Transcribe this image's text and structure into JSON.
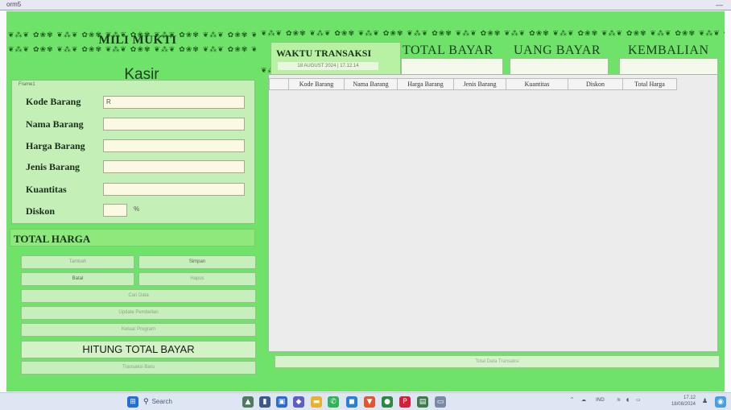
{
  "window": {
    "title": "orm5",
    "minimize": "—"
  },
  "brand": {
    "ornament": "❦⁂❦ ✿❀✾ ❦⁂❦ ✿❀✾ ❦⁂❦ ✿❀✾ ❦⁂❦ ✿❀✾ ❦⁂❦ ✿❀✾ ❦⁂❦ ✿❀✾ ❦⁂❦ ✿❀✾ ❦⁂❦ ✿❀✾ ❦⁂❦ ✿❀✾ ❦⁂❦ ✿❀✾ ❦⁂❦ ✿❀✾ ❦⁂❦ ✿❀✾ ❦⁂❦",
    "title": "MILI MUKTI",
    "subtitle": "Kasir"
  },
  "transaction": {
    "time_label": "WAKTU TRANSAKSI",
    "time_value": "18 AUGUST 2024 | 17.12.14"
  },
  "summary": {
    "total_bayar_label": "TOTAL BAYAR",
    "uang_bayar_label": "UANG BAYAR",
    "kembalian_label": "KEMBALIAN",
    "total_bayar_value": "",
    "uang_bayar_value": "",
    "kembalian_value": ""
  },
  "form": {
    "frame_caption": "Frame1",
    "kode_barang_label": "Kode Barang",
    "kode_barang_value": "R",
    "nama_barang_label": "Nama Barang",
    "nama_barang_value": "",
    "harga_barang_label": "Harga Barang",
    "harga_barang_value": "",
    "jenis_barang_label": "Jenis Barang",
    "jenis_barang_value": "",
    "kuantitas_label": "Kuantitas",
    "kuantitas_value": "",
    "diskon_label": "Diskon",
    "diskon_value": "",
    "diskon_unit": "%"
  },
  "total_harga": {
    "label": "TOTAL HARGA",
    "value": ""
  },
  "buttons": {
    "tambah": "Tambah",
    "simpan": "Simpan",
    "batal": "Batal",
    "hapus": "Hapus",
    "row3": "Cari Data",
    "row4": "Update Pembelian",
    "row5": "Keluar Program",
    "hitung": "HITUNG TOTAL BAYAR",
    "bottom": "Transaksi Baru"
  },
  "table": {
    "columns": [
      "Kode Barang",
      "Nama Barang",
      "Harga Barang",
      "Jenis Barang",
      "Kuantitas",
      "Diskon",
      "Total Harga"
    ],
    "rows": []
  },
  "status_text": "Total Data Transaksi",
  "taskbar": {
    "search_placeholder": "Search",
    "tray_lang": "IND",
    "time": "17.12",
    "date": "18/08/2024",
    "icons": [
      "windows-icon",
      "search-icon",
      "mountain-icon",
      "file-explorer-icon",
      "store-icon",
      "app-icon",
      "folder-icon",
      "whatsapp-icon",
      "photos-icon",
      "brave-icon",
      "chrome-icon",
      "pinterest-icon",
      "store2-icon",
      "notepad-icon"
    ]
  },
  "colors": {
    "form_bg": "#6fe26a",
    "panel_bg": "#c4efb6",
    "grid_bg": "#ececec",
    "input_bg": "#fbf8e4"
  }
}
